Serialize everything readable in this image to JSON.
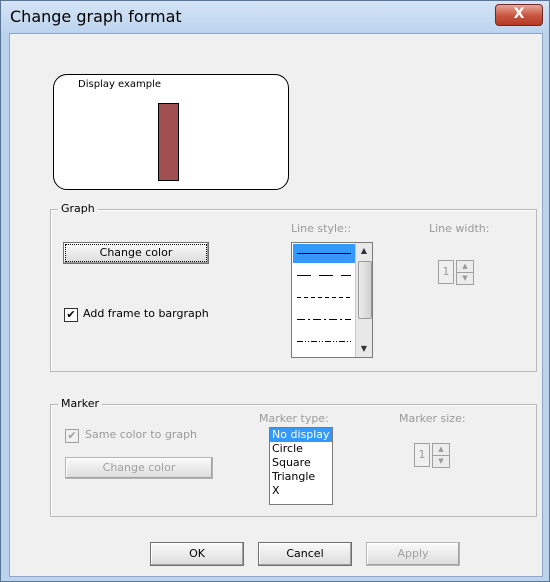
{
  "window": {
    "title": "Change graph format",
    "close_glyph": "X"
  },
  "display_example": {
    "label": "Display example",
    "bar_color": "#a05050"
  },
  "graph_group": {
    "label": "Graph",
    "change_color_label": "Change color",
    "add_frame_label": "Add frame to bargraph",
    "add_frame_checked": true,
    "line_style_label": "Line style::",
    "line_width_label": "Line width:",
    "line_width_value": "1",
    "line_styles": [
      "solid",
      "long-dash",
      "dash",
      "dash-dot",
      "dash-dot-dot"
    ]
  },
  "marker_group": {
    "label": "Marker",
    "same_color_label": "Same color to graph",
    "same_color_checked": true,
    "change_color_label": "Change color",
    "marker_type_label": "Marker type:",
    "marker_size_label": "Marker size:",
    "marker_size_value": "1",
    "marker_types": [
      "No display",
      "Circle",
      "Square",
      "Triangle",
      "X"
    ],
    "selected_marker": "No display"
  },
  "buttons": {
    "ok": "OK",
    "cancel": "Cancel",
    "apply": "Apply"
  },
  "colors": {
    "accent": "#3399ff",
    "frame": "#bcd3ee",
    "close": "#c8533d"
  }
}
